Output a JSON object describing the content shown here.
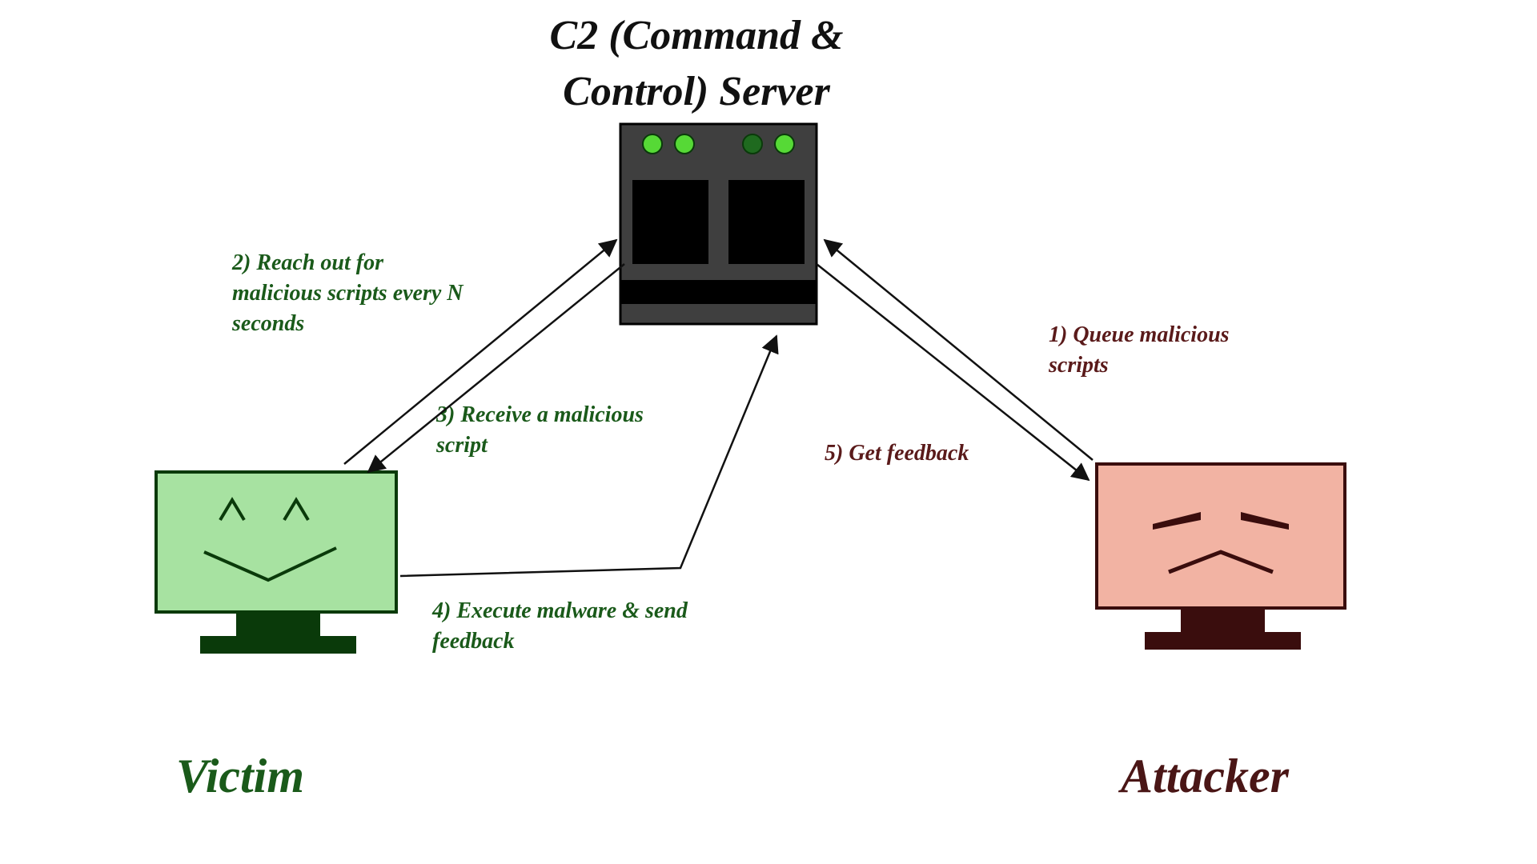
{
  "nodes": {
    "server": {
      "title": "C2 (Command & Control) Server"
    },
    "victim": {
      "title": "Victim"
    },
    "attacker": {
      "title": "Attacker"
    }
  },
  "steps": {
    "s1": "1) Queue malicious scripts",
    "s2": "2) Reach out for malicious scripts every N seconds",
    "s3": "3) Receive a malicious script",
    "s4": "4) Execute malware & send feedback",
    "s5": "5) Get feedback"
  },
  "colors": {
    "server_body": "#3f3f3f",
    "server_dark": "#000000",
    "led_on": "#56d936",
    "led_off": "#1f6a1f",
    "victim_fill": "#a7e2a1",
    "victim_stroke": "#0a3a0a",
    "attacker_fill": "#f2b3a3",
    "attacker_stroke": "#3a0d0d"
  }
}
